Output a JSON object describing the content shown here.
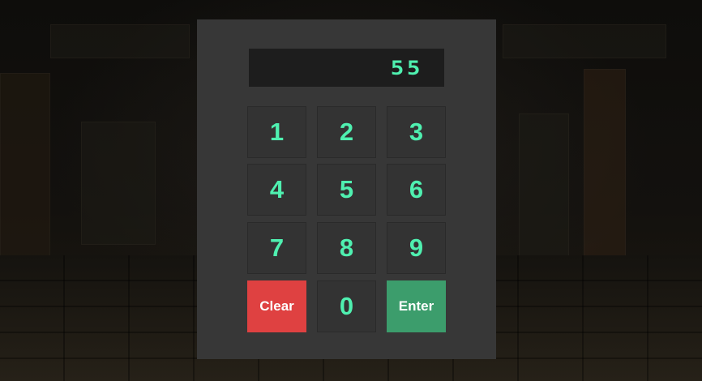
{
  "keypad": {
    "display_value": "55",
    "keys": {
      "k1": "1",
      "k2": "2",
      "k3": "3",
      "k4": "4",
      "k5": "5",
      "k6": "6",
      "k7": "7",
      "k8": "8",
      "k9": "9",
      "k0": "0",
      "clear": "Clear",
      "enter": "Enter"
    }
  },
  "colors": {
    "digit_text": "#4ff0b0",
    "panel": "#373737",
    "display_bg": "#1d1d1d",
    "clear_button": "#df4141",
    "enter_button": "#3c9d6c"
  }
}
